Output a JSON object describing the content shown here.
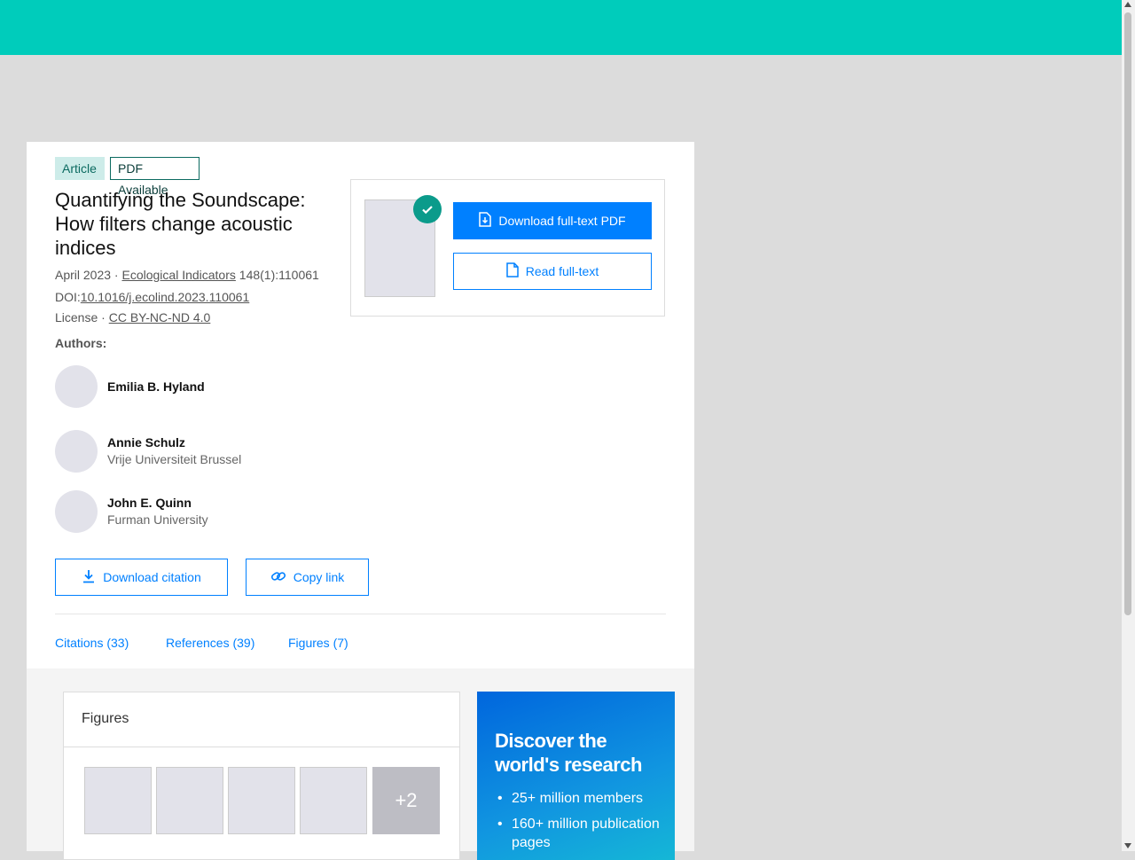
{
  "article": {
    "badge_type": "Article",
    "badge_pdf": "PDF Available",
    "title": "Quantifying the Soundscape: How filters change acoustic indices",
    "date": "April 2023 · ",
    "journal": "Ecological Indicators",
    "volume": " 148(1):110061",
    "doi_label": "DOI:",
    "doi": "10.1016/j.ecolind.2023.110061",
    "license_label": "License · ",
    "license": "CC BY-NC-ND 4.0"
  },
  "authors": {
    "label": "Authors:",
    "list": [
      {
        "name": "Emilia B. Hyland",
        "affiliation": ""
      },
      {
        "name": "Annie Schulz",
        "affiliation": "Vrije Universiteit Brussel"
      },
      {
        "name": "John E. Quinn",
        "affiliation": "Furman University"
      }
    ]
  },
  "actions": {
    "download_pdf": "Download full-text PDF",
    "read_fulltext": "Read full-text",
    "download_citation": "Download citation",
    "copy_link": "Copy link"
  },
  "tabs": [
    {
      "label": "Citations (33)"
    },
    {
      "label": "References (39)"
    },
    {
      "label": "Figures (7)"
    }
  ],
  "figures": {
    "title": "Figures",
    "more": "+2"
  },
  "promo": {
    "title": "Discover the world's research",
    "items": [
      "25+ million members",
      "160+ million publication pages"
    ]
  },
  "colors": {
    "header": "#00ccbb",
    "primary": "#0080ff",
    "accent": "#0b9b8b"
  }
}
